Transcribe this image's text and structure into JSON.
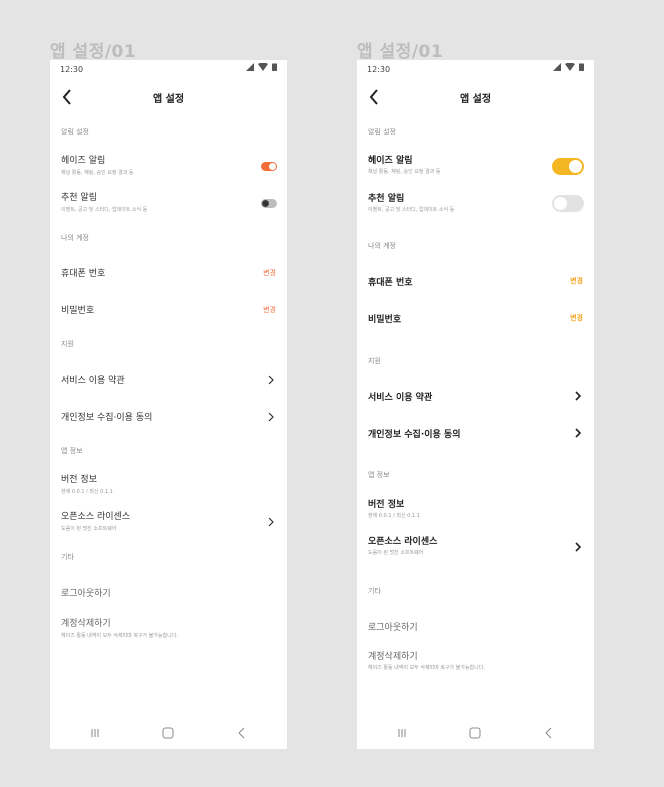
{
  "frames": [
    {
      "frame_title": "앱 설정/01",
      "status_time": "12:30",
      "header_title": "앱 설정",
      "notification_section": "알림 설정",
      "haze_alert_title": "헤이즈 알림",
      "haze_alert_sub": "채널 활동, 채팅, 승인 요청 결과 등",
      "haze_alert_on": true,
      "recommend_alert_title": "추천 알림",
      "recommend_alert_sub": "이벤트, 공고 및 스터디, 업데이트 소식 등",
      "recommend_alert_on": false,
      "account_section": "나의 계정",
      "phone_title": "휴대폰 번호",
      "phone_change": "변경",
      "password_title": "비밀번호",
      "password_change": "변경",
      "support_section": "지원",
      "terms_title": "서비스 이용 약관",
      "privacy_title": "개인정보 수집·이용 동의",
      "app_info_section": "앱 정보",
      "version_title": "버전 정보",
      "version_sub": "현재 0.0.1 / 최신 0.1.1",
      "oss_title": "오픈소스 라이센스",
      "oss_sub": "도움이 된 멋진 소프트웨어",
      "etc_section": "기타",
      "logout_title": "로그아웃하기",
      "delete_title": "계정삭제하기",
      "delete_sub": "헤이즈 활동 내역이 모두 삭제되며 복구가 불가능합니다."
    },
    {
      "frame_title": "앱 설정/01",
      "status_time": "12:30",
      "header_title": "앱 설정",
      "notification_section": "알림 설정",
      "haze_alert_title": "헤이즈 알림",
      "haze_alert_sub": "채널 활동, 채팅, 승인 요청 결과 등",
      "haze_alert_on": true,
      "recommend_alert_title": "추천 알림",
      "recommend_alert_sub": "이벤트, 공고 및 스터디, 업데이트 소식 등",
      "recommend_alert_on": false,
      "account_section": "나의 계정",
      "phone_title": "휴대폰 번호",
      "phone_change": "변경",
      "password_title": "비밀번호",
      "password_change": "변경",
      "support_section": "지원",
      "terms_title": "서비스 이용 약관",
      "privacy_title": "개인정보 수집·이용 동의",
      "app_info_section": "앱 정보",
      "version_title": "버전 정보",
      "version_sub": "현재 0.0.1 / 최신 0.1.1",
      "oss_title": "오픈소스 라이센스",
      "oss_sub": "도움이 된 멋진 소프트웨어",
      "etc_section": "기타",
      "logout_title": "로그아웃하기",
      "delete_title": "계정삭제하기",
      "delete_sub": "헤이즈 활동 내역이 모두 삭제되며 복구가 불가능합니다."
    }
  ],
  "colors": {
    "background": "#e4e4e4",
    "toggle_on_a": "#f26f3a",
    "toggle_on_b": "#f5b623",
    "link_a": "#f26f3a",
    "link_b": "#f5a623"
  },
  "icons": [
    "back-arrow-icon",
    "chevron-right-icon",
    "signal-icon",
    "wifi-icon",
    "battery-icon",
    "recent-apps-icon",
    "home-icon",
    "nav-back-icon"
  ]
}
